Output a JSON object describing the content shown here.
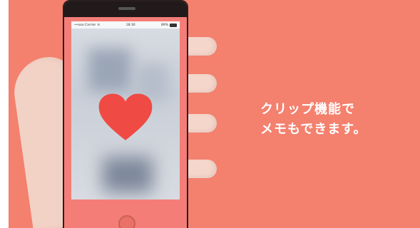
{
  "caption": {
    "line1": "クリップ機能で",
    "line2": "メモもできます。"
  },
  "status_bar": {
    "carrier": "••ooo Carrier",
    "time": "18:30",
    "battery": "89%"
  },
  "colors": {
    "background": "#f4806e",
    "heart": "#f04a44"
  },
  "icons": {
    "heart": "heart-icon",
    "wifi": "wifi-icon",
    "battery": "battery-icon",
    "home_button": "home-button-icon"
  }
}
